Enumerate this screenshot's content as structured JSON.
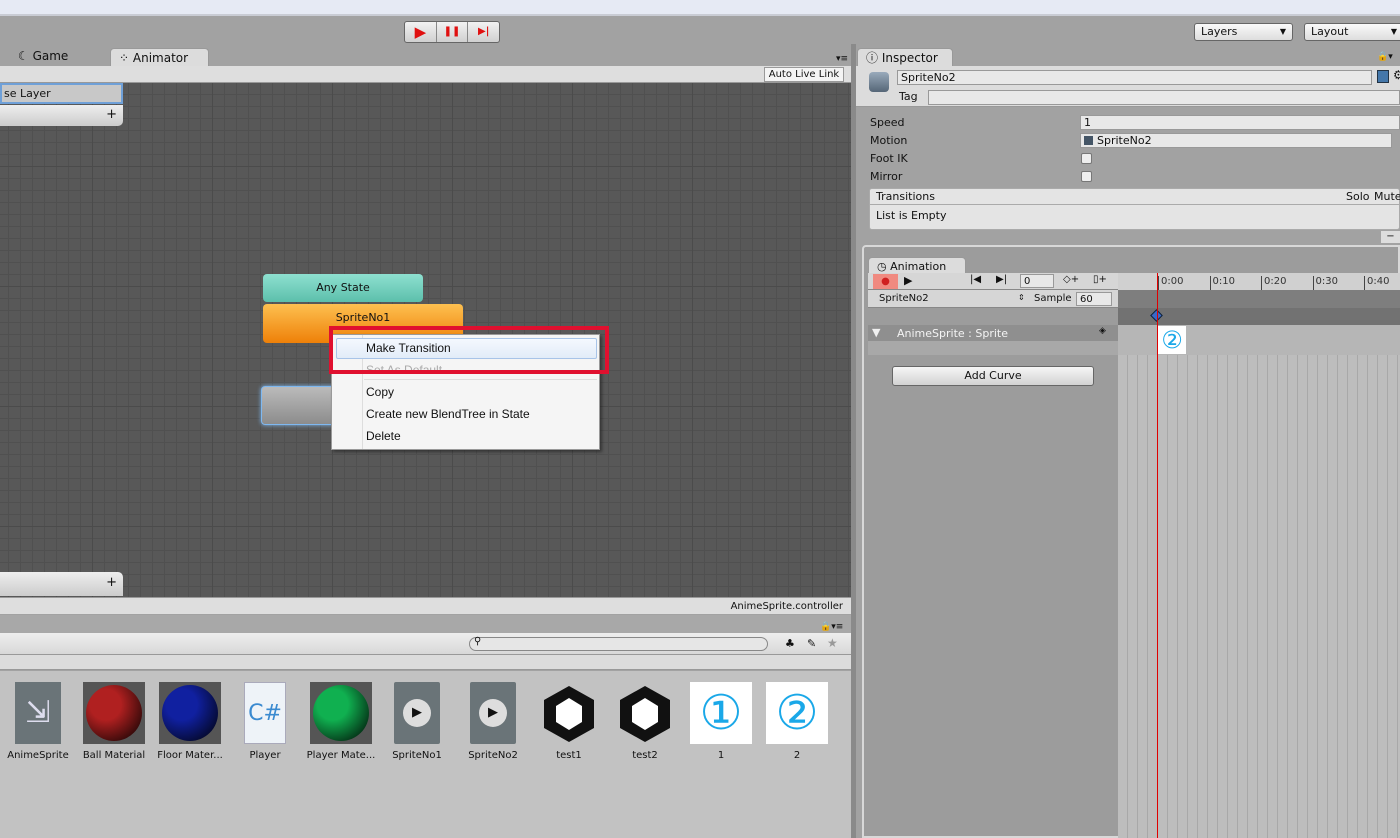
{
  "toolbar": {
    "play": "▶",
    "pause": "❚❚",
    "step": "▶|",
    "layers": "Layers",
    "layout": "Layout"
  },
  "tabs": {
    "game": "Game",
    "animator": "Animator",
    "inspector": "Inspector",
    "animation": "Animation"
  },
  "animator": {
    "auto_live_link": "Auto Live Link",
    "layer": "se Layer",
    "add": "+",
    "controller": "AnimeSprite.controller",
    "states": {
      "any": "Any State",
      "sprite1": "SpriteNo1",
      "sprite1_color": "#f7a21b",
      "any_color": "#6fcfbd"
    }
  },
  "context_menu": {
    "items": [
      "Make Transition",
      "Set As Default",
      "Copy",
      "Create new BlendTree in State",
      "Delete"
    ],
    "highlight_color": "#e0102f"
  },
  "inspector": {
    "name": "SpriteNo2",
    "tag_label": "Tag",
    "speed_label": "Speed",
    "speed": "1",
    "motion_label": "Motion",
    "motion": "SpriteNo2",
    "foot_ik_label": "Foot IK",
    "mirror_label": "Mirror",
    "transitions": "Transitions",
    "solo": "Solo",
    "mute": "Mute",
    "empty": "List is Empty"
  },
  "animation": {
    "frame": "0",
    "clip": "SpriteNo2",
    "sample_label": "Sample",
    "sample": "60",
    "track": "AnimeSprite : Sprite",
    "add_curve": "Add Curve",
    "ticks": [
      "0:00",
      "0:10",
      "0:20",
      "0:30",
      "0:40"
    ],
    "key_sprite": "②"
  },
  "project": {
    "search_placeholder": "",
    "assets": [
      {
        "name": "AnimeSprite",
        "icon": "animator-controller-icon"
      },
      {
        "name": "Ball Material",
        "icon": "sphere-icon",
        "color": "#b02020"
      },
      {
        "name": "Floor Mater...",
        "icon": "sphere-icon",
        "color": "#1020a0"
      },
      {
        "name": "Player",
        "icon": "csharp-script-icon"
      },
      {
        "name": "Player Mate...",
        "icon": "sphere-icon",
        "color": "#10b050"
      },
      {
        "name": "SpriteNo1",
        "icon": "animation-clip-icon"
      },
      {
        "name": "SpriteNo2",
        "icon": "animation-clip-icon"
      },
      {
        "name": "test1",
        "icon": "unity-logo-icon"
      },
      {
        "name": "test2",
        "icon": "unity-logo-icon"
      },
      {
        "name": "1",
        "icon": "sprite-icon",
        "glyph": "①"
      },
      {
        "name": "2",
        "icon": "sprite-icon",
        "glyph": "②"
      }
    ]
  }
}
